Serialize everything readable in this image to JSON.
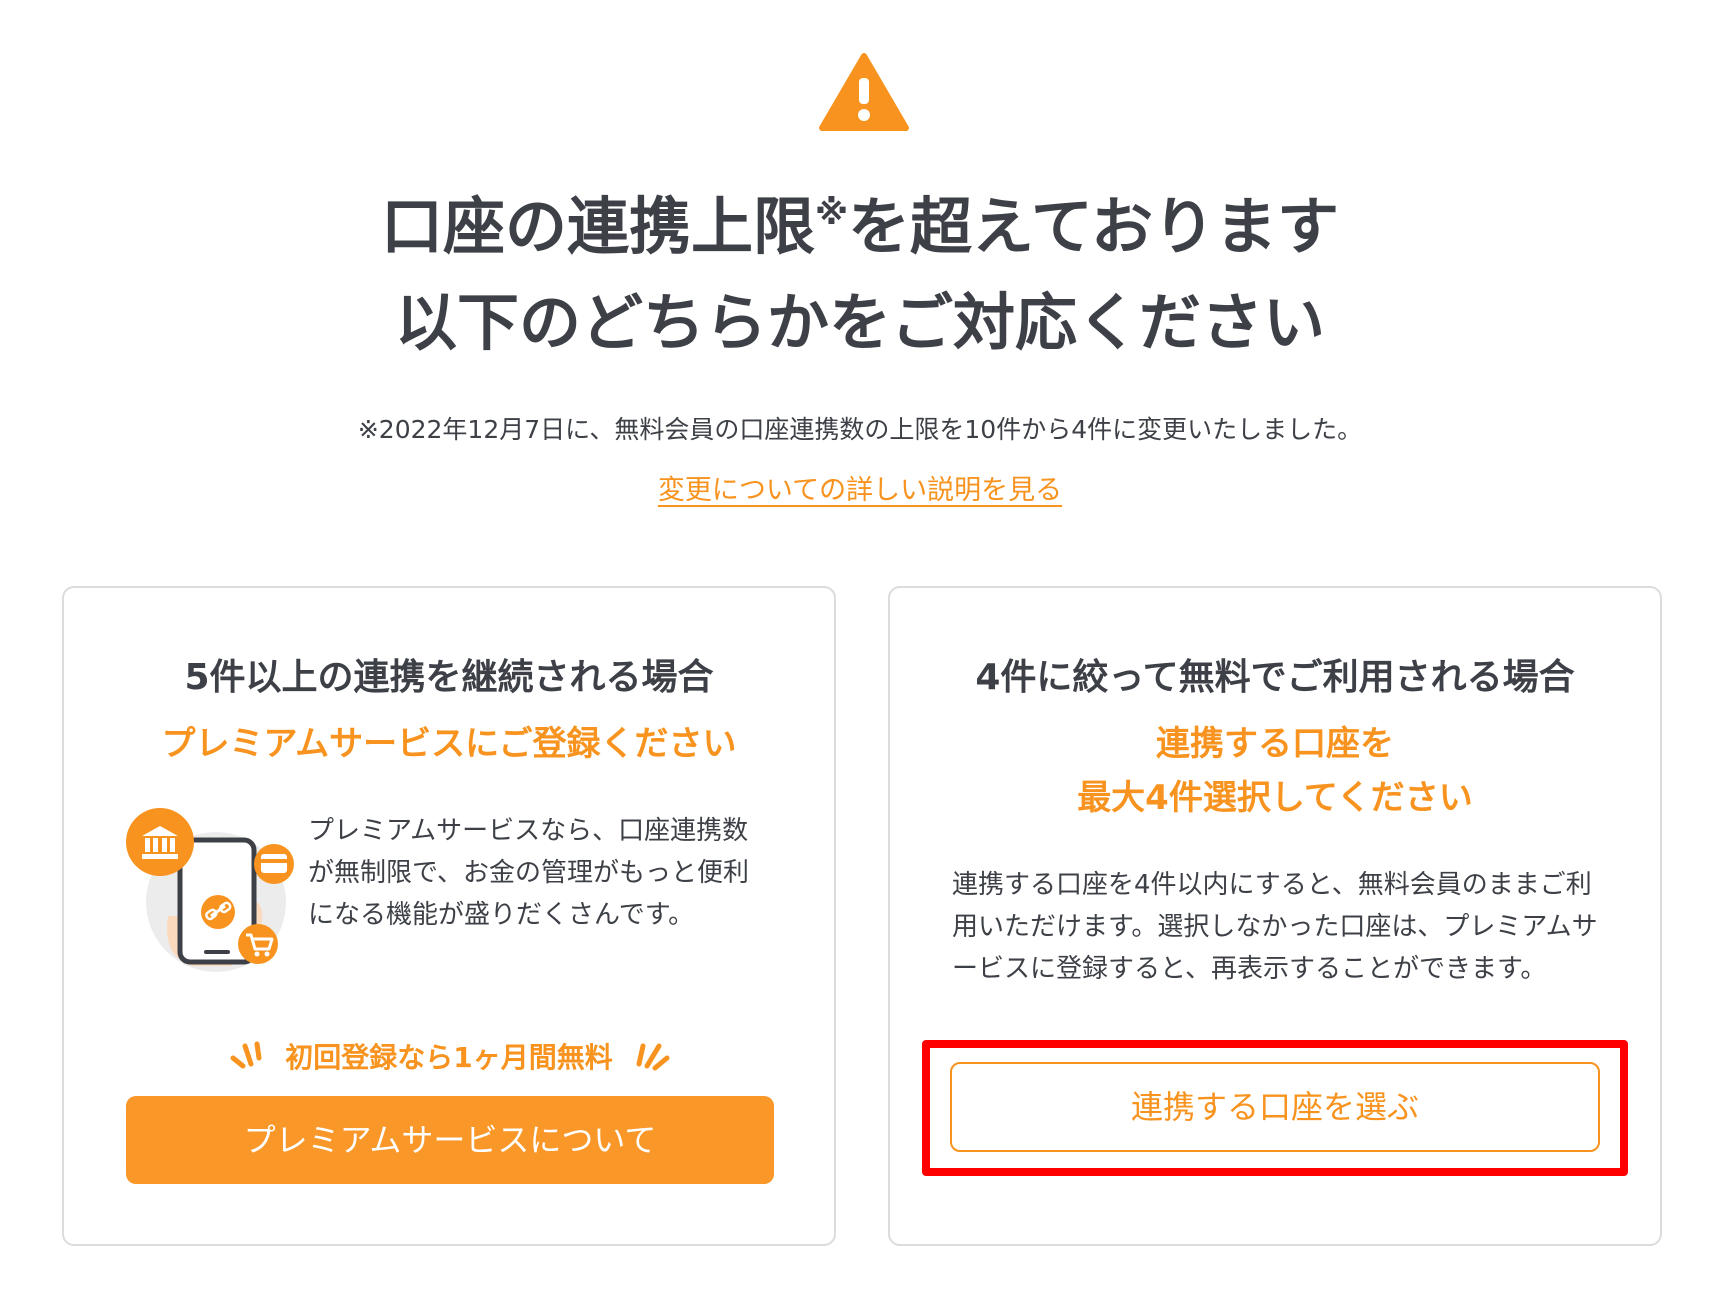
{
  "header": {
    "icon": "warning-icon",
    "title_line1_before": "口座の連携上限",
    "title_line1_mark": "※",
    "title_line1_after": "を超えております",
    "title_line2": "以下のどちらかをご対応ください",
    "notice": "※2022年12月7日に、無料会員の口座連携数の上限を10件から4件に変更いたしました。",
    "detail_link": "変更についての詳しい説明を見る"
  },
  "left_card": {
    "title": "5件以上の連携を継続される場合",
    "subtitle": "プレミアムサービスにご登録ください",
    "illustration_icons": [
      "bank-icon",
      "card-icon",
      "link-icon",
      "cart-icon",
      "smartphone-icon"
    ],
    "description": "プレミアムサービスなら、口座連携数が無制限で、お金の管理がもっと便利になる機能が盛りだくさんです。",
    "promo": "初回登録なら1ヶ月間無料",
    "button_label": "プレミアムサービスについて"
  },
  "right_card": {
    "title": "4件に絞って無料でご利用される場合",
    "subtitle_line1": "連携する口座を",
    "subtitle_line2": "最大4件選択してください",
    "description": "連携する口座を4件以内にすると、無料会員のままご利用いただけます。選択しなかった口座は、プレミアムサービスに登録すると、再表示することができます。",
    "button_label": "連携する口座を選ぶ"
  },
  "colors": {
    "accent": "#f7931e",
    "button_fill": "#f99728",
    "text": "#3d4147",
    "highlight": "#ff0000",
    "card_border": "#dcdcdc"
  }
}
